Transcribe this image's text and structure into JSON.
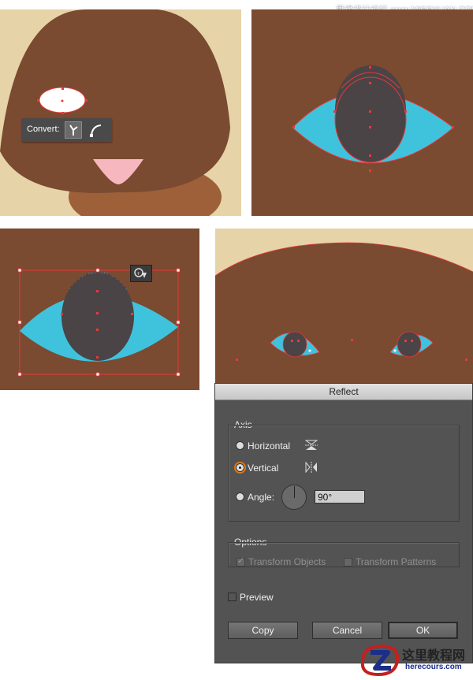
{
  "watermark": "思缘设计论坛 www.MISSYUAN.COM",
  "colors": {
    "fur_brown": "#7a4a31",
    "cream": "#e6d3a8",
    "eye_blue": "#3fc3dc",
    "pupil": "#4a4446",
    "nose_pink": "#f7b7be",
    "anchor_red": "#e8393a"
  },
  "convert_toolbar": {
    "label": "Convert:",
    "corner_icon": "convert-anchor-corner-icon",
    "smooth_icon": "convert-anchor-smooth-icon"
  },
  "reflect_dialog": {
    "title": "Reflect",
    "axis_group": "Axis",
    "axis_options": [
      {
        "label": "Horizontal",
        "selected": false,
        "icon": "reflect-horizontal-icon"
      },
      {
        "label": "Vertical",
        "selected": true,
        "icon": "reflect-vertical-icon"
      }
    ],
    "angle_label": "Angle:",
    "angle_value": "90°",
    "options_group": "Options",
    "transform_objects": "Transform Objects",
    "transform_patterns": "Transform Patterns",
    "preview": "Preview",
    "buttons": {
      "copy": "Copy",
      "cancel": "Cancel",
      "ok": "OK"
    }
  },
  "site_logo": {
    "name": "这里教程网",
    "url": "herecours.com"
  }
}
